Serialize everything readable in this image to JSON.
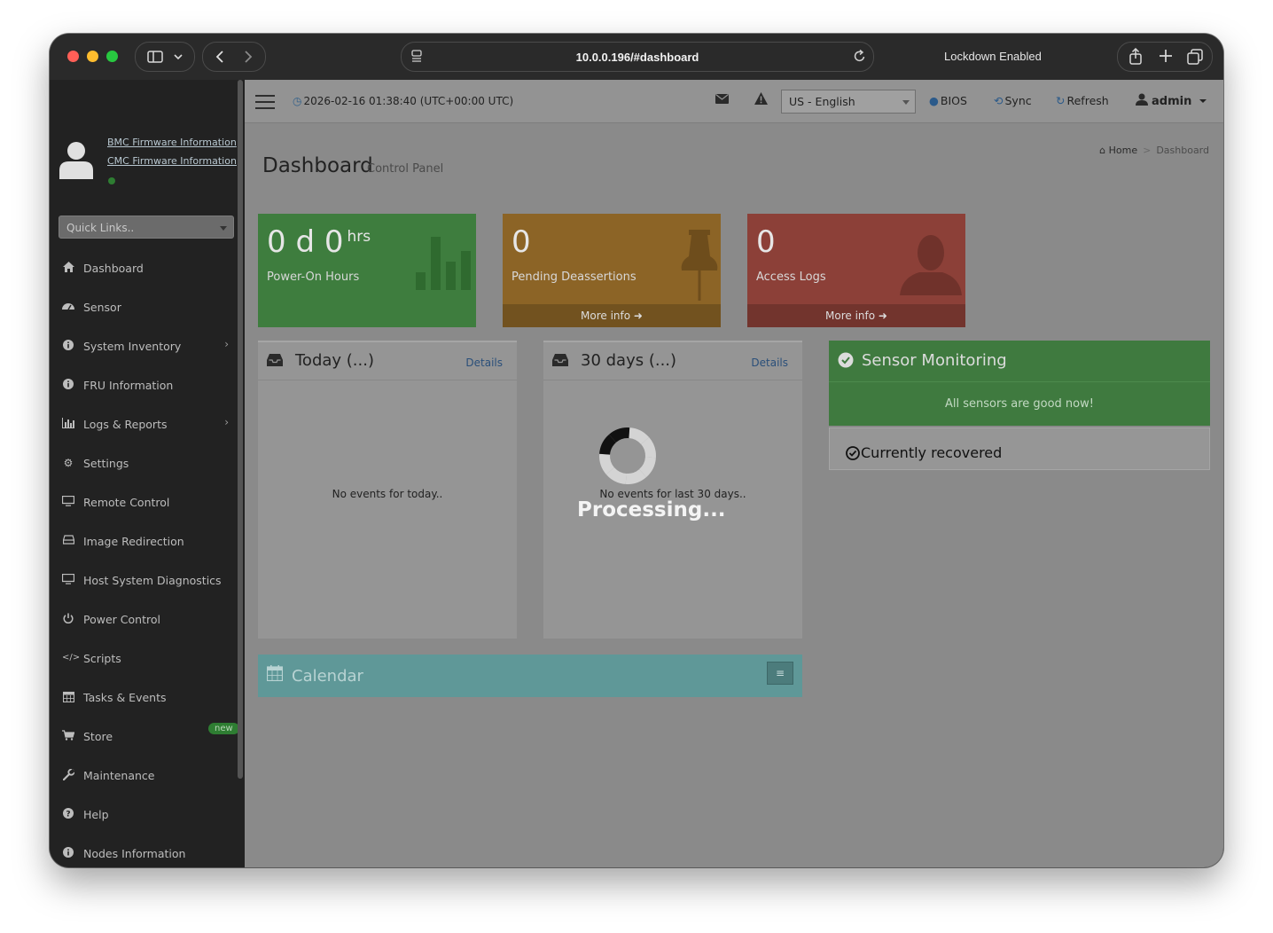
{
  "browser": {
    "url": "10.0.0.196/#dashboard",
    "status_text": "Lockdown Enabled"
  },
  "sidebar": {
    "firmware_links": [
      "BMC Firmware Information",
      "CMC Firmware Information"
    ],
    "quick_links_placeholder": "Quick Links..",
    "items": [
      {
        "label": "Dashboard",
        "icon": "home-icon"
      },
      {
        "label": "Sensor",
        "icon": "dashboard-gauge-icon"
      },
      {
        "label": "System Inventory",
        "icon": "info-circle-icon",
        "has_submenu": true
      },
      {
        "label": "FRU Information",
        "icon": "info-circle-icon"
      },
      {
        "label": "Logs & Reports",
        "icon": "bar-chart-icon",
        "has_submenu": true
      },
      {
        "label": "Settings",
        "icon": "gear-icon"
      },
      {
        "label": "Remote Control",
        "icon": "monitor-icon"
      },
      {
        "label": "Image Redirection",
        "icon": "drive-icon"
      },
      {
        "label": "Host System Diagnostics",
        "icon": "monitor-icon"
      },
      {
        "label": "Power Control",
        "icon": "power-icon"
      },
      {
        "label": "Scripts",
        "icon": "code-icon"
      },
      {
        "label": "Tasks & Events",
        "icon": "calendar-icon"
      },
      {
        "label": "Store",
        "icon": "cart-icon",
        "badge": "new"
      },
      {
        "label": "Maintenance",
        "icon": "wrench-icon"
      },
      {
        "label": "Help",
        "icon": "question-circle-icon"
      },
      {
        "label": "Nodes Information",
        "icon": "info-circle-icon"
      }
    ]
  },
  "topbar": {
    "datetime": "2026-02-16 01:38:40 (UTC+00:00 UTC)",
    "language": "US - English",
    "bios_label": "BIOS",
    "sync_label": "Sync",
    "refresh_label": "Refresh",
    "user_label": "admin"
  },
  "page": {
    "title": "Dashboard",
    "subtitle": "Control Panel",
    "breadcrumb": [
      "Home",
      "Dashboard"
    ]
  },
  "tiles": [
    {
      "value": "0 d 0",
      "unit": "hrs",
      "caption": "Power-On Hours",
      "color": "#3e7d3e"
    },
    {
      "value": "0",
      "caption": "Pending Deassertions",
      "footer": "More info",
      "color": "#8c6426"
    },
    {
      "value": "0",
      "caption": "Access Logs",
      "footer": "More info",
      "color": "#8c4038"
    }
  ],
  "today_box": {
    "title": "Today (...)",
    "details": "Details",
    "message": "No events for today.."
  },
  "month_box": {
    "title": "30 days (...)",
    "details": "Details",
    "message": "No events for last 30 days.."
  },
  "sensor_monitoring": {
    "title": "Sensor Monitoring",
    "message": "All sensors are good now!",
    "recovered": "Currently recovered"
  },
  "calendar": {
    "title": "Calendar"
  },
  "overlay": {
    "processing_text": "Processing..."
  }
}
